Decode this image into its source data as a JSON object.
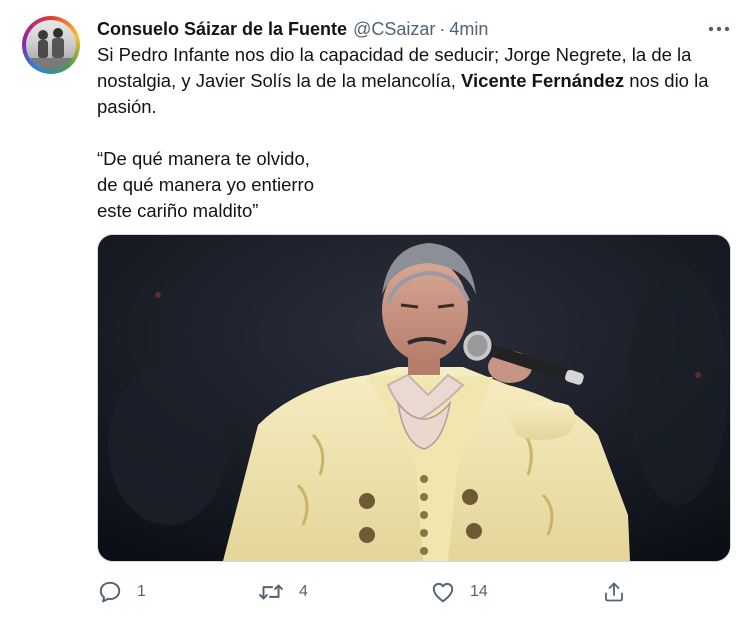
{
  "tweet": {
    "author_name": "Consuelo Sáizar de la Fuente",
    "author_handle": "@CSaizar",
    "separator": "·",
    "time": "4min",
    "text": {
      "p1_before": "Si Pedro Infante nos dio la capacidad de seducir; Jorge Negrete, la de la nostalgia, y Javier Solís la de la melancolía, ",
      "p1_bold": "Vicente Fernández",
      "p1_after": " nos dio la pasión.",
      "quote_line1": "“De qué manera te olvido,",
      "quote_line2": "de qué manera yo entierro",
      "quote_line3": "este cariño maldito”"
    }
  },
  "actions": {
    "reply_count": "1",
    "retweet_count": "4",
    "like_count": "14"
  },
  "icons": {
    "more": "more-dots-icon",
    "reply": "reply-icon",
    "retweet": "retweet-icon",
    "like": "heart-icon",
    "share": "share-icon"
  },
  "colors": {
    "text_primary": "#0f1419",
    "text_secondary": "#536471",
    "border": "#cfd9de",
    "suit": "#f2e7b4",
    "background": "#ffffff"
  }
}
